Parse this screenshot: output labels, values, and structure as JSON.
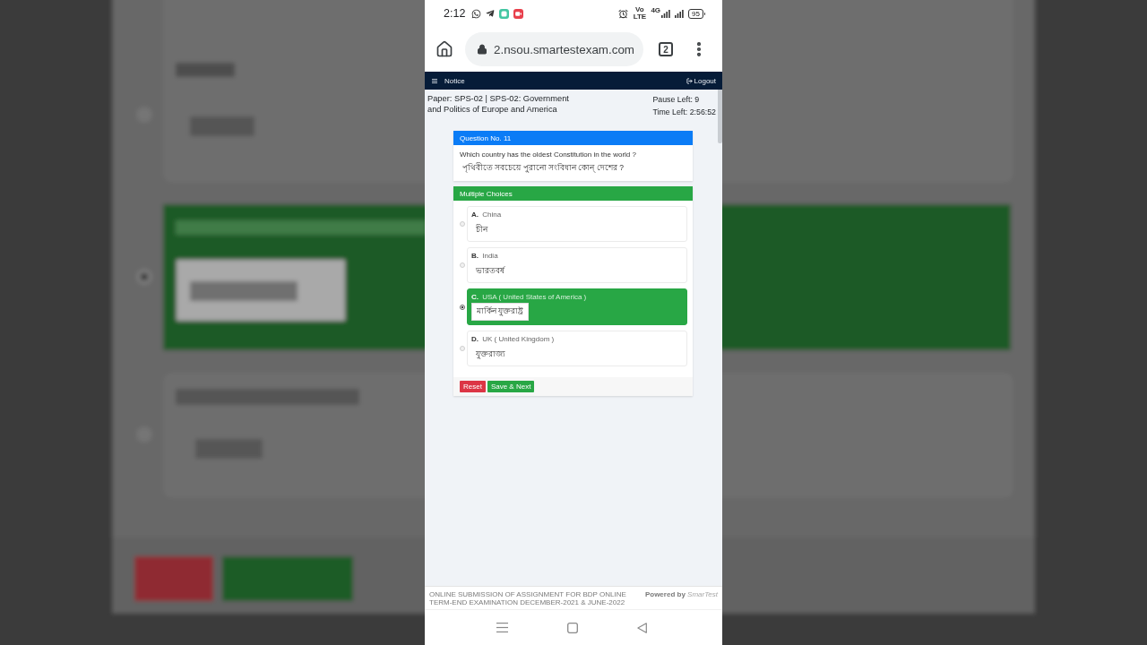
{
  "status_bar": {
    "time": "2:12",
    "volte": "Vo LTE",
    "network": "4G",
    "battery": "95"
  },
  "browser": {
    "url": "2.nsou.smartestexam.com",
    "tab_count": "2"
  },
  "navbar": {
    "notice": "Notice",
    "logout": "Logout"
  },
  "exam_header": {
    "paper": "Paper: SPS-02 | SPS-02: Government and Politics of Europe and America",
    "pause_left": "Pause Left: 9",
    "time_left": "Time Left: 2:56:52"
  },
  "question": {
    "heading": "Question No. 11",
    "text": "Which country has the oldest Constitution in the world ?",
    "translation": "পৃথিবীতে সবচেয়ে পুরানো সংবিধান কোন্ দেশের ?"
  },
  "choices": {
    "heading": "Multiple Choices",
    "options": [
      {
        "letter": "A.",
        "label": "China",
        "answer": "চীন",
        "selected": false
      },
      {
        "letter": "B.",
        "label": "India",
        "answer": "ভারতবর্ষ",
        "selected": false
      },
      {
        "letter": "C.",
        "label": "USA ( United States of America )",
        "answer": "মার্কিন যুক্তরাষ্ট্র",
        "selected": true
      },
      {
        "letter": "D.",
        "label": "UK ( United Kingdom )",
        "answer": "যুক্তরাজ্য",
        "selected": false
      }
    ]
  },
  "actions": [
    {
      "label": "Reset",
      "kind": "danger"
    },
    {
      "label": "Save & Next",
      "kind": "success"
    }
  ],
  "footer": {
    "notice": "ONLINE SUBMISSION OF ASSIGNMENT FOR BDP ONLINE TERM-END EXAMINATION DECEMBER-2021 & JUNE-2022",
    "credit": "**Powered by** SmarTest"
  }
}
